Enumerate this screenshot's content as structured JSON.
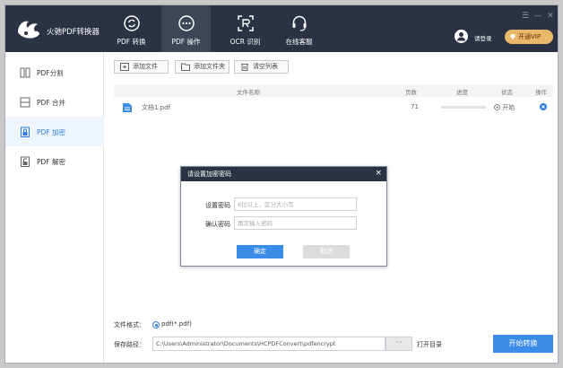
{
  "app": {
    "title": "火驰PDF转换器",
    "login": "请登录",
    "vip": "开通VIP",
    "window_controls": [
      "☰",
      "—",
      "✕"
    ]
  },
  "nav": {
    "tabs": [
      {
        "label": "PDF 转换",
        "icon": "convert-icon",
        "active": false
      },
      {
        "label": "PDF 操作",
        "icon": "chat-icon",
        "active": true
      },
      {
        "label": "OCR 识别",
        "icon": "ocr-icon",
        "active": false
      },
      {
        "label": "在线客服",
        "icon": "headset-icon",
        "active": false
      }
    ]
  },
  "sidebar": {
    "items": [
      {
        "label": "PDF分割",
        "icon": "split-icon",
        "active": false
      },
      {
        "label": "PDF 合并",
        "icon": "merge-icon",
        "active": false
      },
      {
        "label": "PDF 加密",
        "icon": "lock-icon",
        "active": true
      },
      {
        "label": "PDF 解密",
        "icon": "unlock-icon",
        "active": false
      }
    ]
  },
  "toolbar": {
    "add_file": "添加文件",
    "add_folder": "添加文件夹",
    "clear_list": "清空列表"
  },
  "table": {
    "headers": {
      "name": "文件名称",
      "pages": "页数",
      "progress": "进度",
      "status": "状态",
      "action": "操作"
    },
    "rows": [
      {
        "name": "文档1.pdf",
        "pages": "71",
        "progress": 0,
        "status": "开始"
      }
    ]
  },
  "dialog": {
    "title": "请设置加密密码",
    "close": "×",
    "password_label": "设置密码",
    "password_placeholder": "6位以上，区分大小写",
    "confirm_label": "确认密码",
    "confirm_placeholder": "再次输入密码",
    "ok": "确定",
    "cancel": "取消"
  },
  "footer": {
    "format_label": "文件格式：",
    "format_value": "pdf(*.pdf)",
    "path_label": "保存路径：",
    "path_value": "C:\\Users\\Administrator\\Documents\\HCPDFConvert\\pdfencrypt",
    "browse": "···",
    "open_dir": "打开目录",
    "start": "开始转换"
  },
  "colors": {
    "header_bg": "#2b3243",
    "accent": "#3b8be8",
    "vip": "#e9b86b"
  }
}
